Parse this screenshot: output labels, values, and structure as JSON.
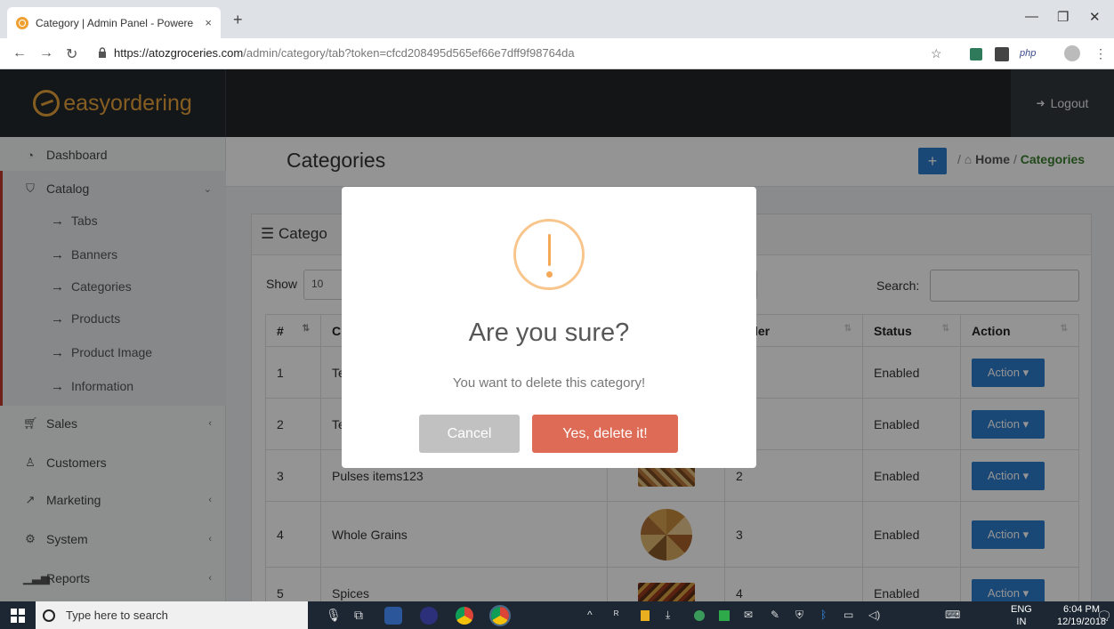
{
  "browser": {
    "tab_title": "Category | Admin Panel - Powere",
    "tab_close": "×",
    "new_tab": "+",
    "url_host": "https://atozgroceries.com",
    "url_path": "/admin/category/tab?token=cfcd208495d565ef66e7dff9f98764da",
    "ext_php": "php"
  },
  "header": {
    "logo_text": "easyordering",
    "logout_label": "Logout"
  },
  "sidebar": {
    "items": [
      {
        "label": "Dashboard",
        "icon": "dashboard-icon"
      },
      {
        "label": "Catalog",
        "icon": "catalog-icon"
      },
      {
        "label": "Sales",
        "icon": "cart-icon"
      },
      {
        "label": "Customers",
        "icon": "user-icon"
      },
      {
        "label": "Marketing",
        "icon": "share-icon"
      },
      {
        "label": "System",
        "icon": "gear-icon"
      },
      {
        "label": "Reports",
        "icon": "bar-chart-icon"
      }
    ],
    "catalog_sub": [
      "Tabs",
      "Banners",
      "Categories",
      "Products",
      "Product Image",
      "Information"
    ]
  },
  "page": {
    "title": "Categories",
    "breadcrumb_home": "Home",
    "breadcrumb_current": "Categories",
    "breadcrumb_sep": "/",
    "card_title": "Catego",
    "show_label": "Show",
    "show_value": "10",
    "search_label": "Search:",
    "search_value": ""
  },
  "table": {
    "headers": [
      "#",
      "C",
      "",
      "Order",
      "Status",
      "Action"
    ],
    "rows": [
      {
        "num": "1",
        "name": "Te",
        "order": "",
        "status": "Enabled",
        "action": "Action ▾"
      },
      {
        "num": "2",
        "name": "Te",
        "order": "",
        "status": "Enabled",
        "action": "Action ▾"
      },
      {
        "num": "3",
        "name": "Pulses items123",
        "order": "2",
        "status": "Enabled",
        "action": "Action ▾"
      },
      {
        "num": "4",
        "name": "Whole Grains",
        "order": "3",
        "status": "Enabled",
        "action": "Action ▾"
      },
      {
        "num": "5",
        "name": "Spices",
        "order": "4",
        "status": "Enabled",
        "action": "Action ▾"
      }
    ]
  },
  "modal": {
    "title": "Are you sure?",
    "text": "You want to delete this category!",
    "cancel_label": "Cancel",
    "confirm_label": "Yes, delete it!"
  },
  "taskbar": {
    "search_placeholder": "Type here to search",
    "lang_top": "ENG",
    "lang_bottom": "IN",
    "time": "6:04 PM",
    "date": "12/19/2018"
  },
  "colors": {
    "accent_blue": "#2b7bcb",
    "confirm_red": "#dd6b55",
    "brand_orange": "#e8a23a",
    "breadcrumb_green": "#3a7d2d"
  }
}
